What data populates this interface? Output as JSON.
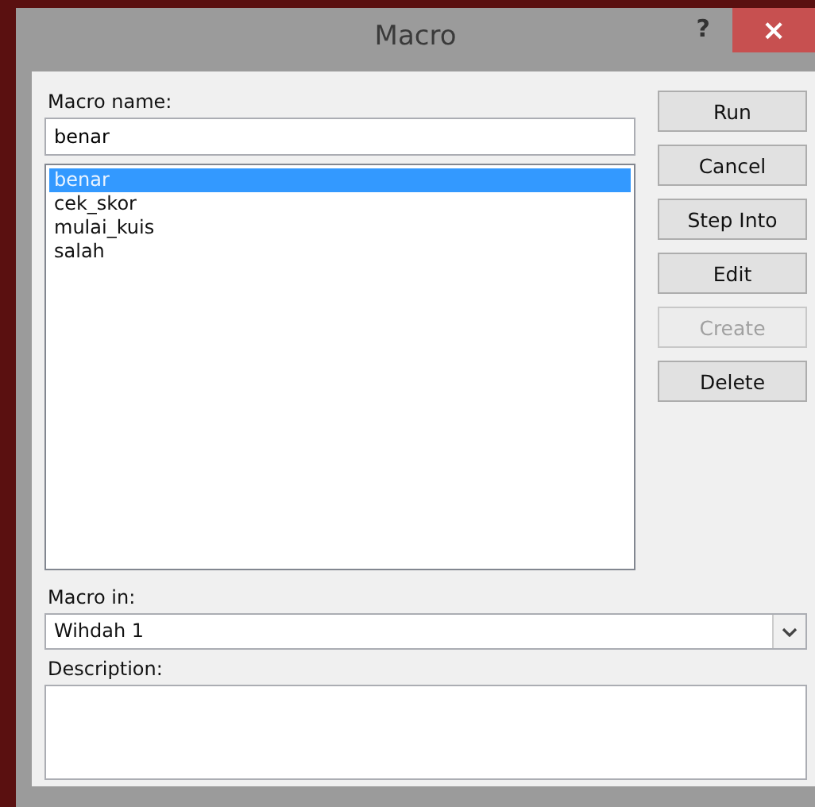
{
  "window": {
    "title": "Macro",
    "help": "?",
    "close": "×"
  },
  "macro_name": {
    "label": "Macro name:",
    "value": "benar"
  },
  "macros": [
    {
      "name": "benar",
      "selected": true
    },
    {
      "name": "cek_skor",
      "selected": false
    },
    {
      "name": "mulai_kuis",
      "selected": false
    },
    {
      "name": "salah",
      "selected": false
    }
  ],
  "buttons": [
    {
      "label": "Run",
      "disabled": false
    },
    {
      "label": "Cancel",
      "disabled": false
    },
    {
      "label": "Step Into",
      "disabled": false
    },
    {
      "label": "Edit",
      "disabled": false
    },
    {
      "label": "Create",
      "disabled": true
    },
    {
      "label": "Delete",
      "disabled": false
    }
  ],
  "macro_in": {
    "label": "Macro in:",
    "value": "Wihdah 1"
  },
  "description": {
    "label": "Description:"
  }
}
